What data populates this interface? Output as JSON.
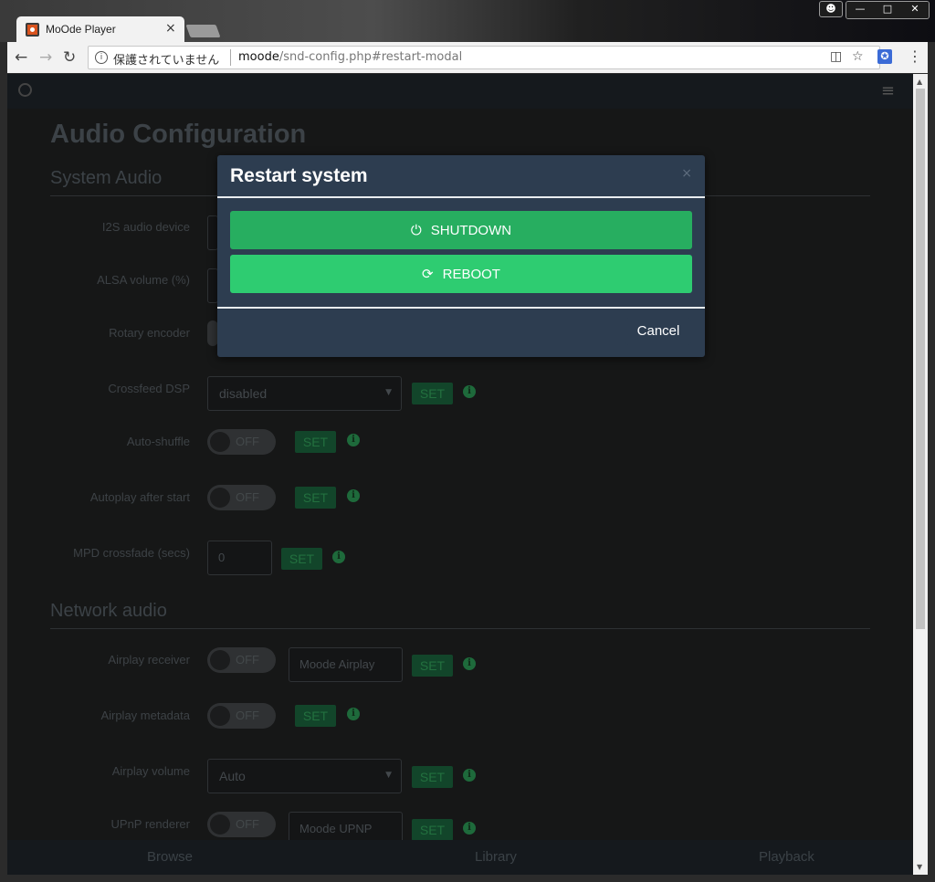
{
  "browser": {
    "tab_title": "MoOde Player",
    "tab_close": "×",
    "url_security_text": "保護されていません",
    "url_host": "moode",
    "url_path": "/snd-config.php#restart-modal"
  },
  "page": {
    "title": "Audio Configuration",
    "sections": {
      "system_audio": "System Audio",
      "network_audio": "Network audio"
    },
    "rows": {
      "i2s": "I2S audio device",
      "alsa": "ALSA volume (%)",
      "rotary": "Rotary encoder",
      "crossfeed": "Crossfeed DSP",
      "autoshuffle": "Auto-shuffle",
      "autoplay": "Autoplay after start",
      "crossfade": "MPD crossfade (secs)",
      "airplay_receiver": "Airplay receiver",
      "airplay_metadata": "Airplay metadata",
      "airplay_volume": "Airplay volume",
      "upnp_renderer": "UPnP renderer"
    },
    "values": {
      "crossfeed": "disabled",
      "crossfade": "0",
      "airplay_name": "Moode Airplay",
      "airplay_volume": "Auto",
      "upnp_name": "Moode UPNP"
    },
    "toggle_off": "OFF",
    "set_label": "SET",
    "info_glyph": "i",
    "caret": "▼"
  },
  "footer": {
    "browse": "Browse",
    "library": "Library",
    "playback": "Playback"
  },
  "modal": {
    "title": "Restart system",
    "close": "×",
    "shutdown": "SHUTDOWN",
    "reboot": "REBOOT",
    "cancel": "Cancel",
    "shutdown_color": "#27ae60",
    "reboot_color": "#2ecc71"
  },
  "icons": {
    "back": "back-arrow-icon",
    "forward": "forward-arrow-icon",
    "reload": "reload-icon",
    "power": "power-icon",
    "refresh": "refresh-icon"
  }
}
